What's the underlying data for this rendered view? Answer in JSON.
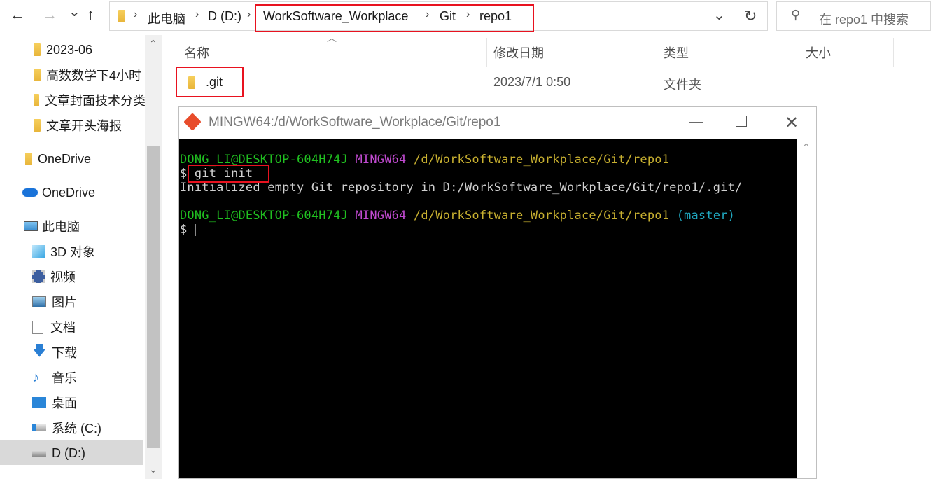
{
  "nav": {
    "back_icon": "←",
    "forward_icon": "→",
    "dropdown_icon": "⌄",
    "up_icon": "↑",
    "breadcrumb": [
      "此电脑",
      "D (D:)",
      "WorkSoftware_Workplace",
      "Git",
      "repo1"
    ],
    "refresh_icon": "↻",
    "search_placeholder": "在 repo1 中搜索"
  },
  "sidebar": {
    "items": [
      {
        "label": "2023-06",
        "icon": "folder-icon"
      },
      {
        "label": "高数数学下4小时",
        "icon": "folder-icon"
      },
      {
        "label": "文章封面技术分类",
        "icon": "folder-icon"
      },
      {
        "label": "文章开头海报",
        "icon": "folder-icon"
      },
      {
        "label": "OneDrive",
        "icon": "folder-icon"
      },
      {
        "label": "OneDrive",
        "icon": "cloud-icon"
      },
      {
        "label": "此电脑",
        "icon": "computer-icon"
      },
      {
        "label": "3D 对象",
        "icon": "cube-icon"
      },
      {
        "label": "视频",
        "icon": "video-icon"
      },
      {
        "label": "图片",
        "icon": "picture-icon"
      },
      {
        "label": "文档",
        "icon": "document-icon"
      },
      {
        "label": "下载",
        "icon": "download-icon"
      },
      {
        "label": "音乐",
        "icon": "music-icon"
      },
      {
        "label": "桌面",
        "icon": "desktop-icon"
      },
      {
        "label": "系统 (C:)",
        "icon": "drive-icon"
      },
      {
        "label": "D (D:)",
        "icon": "drive-icon"
      }
    ]
  },
  "columns": {
    "name": "名称",
    "modified": "修改日期",
    "type": "类型",
    "size": "大小"
  },
  "files": [
    {
      "name": ".git",
      "modified": "2023/7/1 0:50",
      "type": "文件夹"
    }
  ],
  "terminal": {
    "title": "MINGW64:/d/WorkSoftware_Workplace/Git/repo1",
    "user_host": "DONG_LI@DESKTOP-604H74J",
    "shell": "MINGW64",
    "path": "/d/WorkSoftware_Workplace/Git/repo1",
    "prompt": "$",
    "command": "git init",
    "output": "Initialized empty Git repository in D:/WorkSoftware_Workplace/Git/repo1/.git/",
    "branch": "(master)"
  },
  "colors": {
    "highlight_box": "#e8121f",
    "terminal_bg": "#000000",
    "user_green": "#20c020",
    "shell_magenta": "#c04ad0",
    "path_yellow": "#c8b030",
    "branch_cyan": "#20a8c0"
  }
}
